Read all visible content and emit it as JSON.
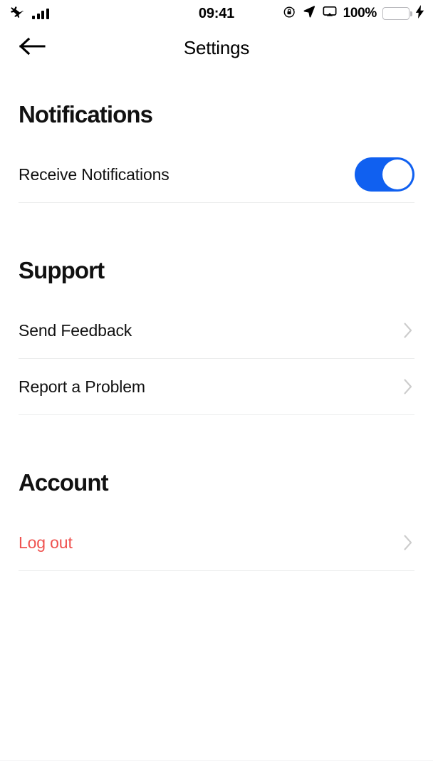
{
  "status_bar": {
    "airplane_icon": "airplane-mode-icon",
    "signal_icon": "cellular-signal-icon",
    "signal_bars": 4,
    "time": "09:41",
    "rotation_lock_icon": "rotation-lock-icon",
    "location_icon": "location-arrow-icon",
    "airplay_icon": "airplay-screen-mirroring-icon",
    "battery_percent": "100%",
    "battery_level": 100,
    "battery_color": "#4cd964",
    "charging_icon": "charging-bolt-icon"
  },
  "navbar": {
    "back_icon": "arrow-left-icon",
    "title": "Settings"
  },
  "sections": [
    {
      "id": "notifications",
      "title": "Notifications",
      "rows": [
        {
          "label": "Receive Notifications",
          "control": "toggle",
          "value": "on",
          "accent": "#1060f0"
        }
      ]
    },
    {
      "id": "support",
      "title": "Support",
      "rows": [
        {
          "label": "Send Feedback",
          "control": "chevron",
          "chevron_icon": "chevron-right-icon"
        },
        {
          "label": "Report a Problem",
          "control": "chevron",
          "chevron_icon": "chevron-right-icon"
        }
      ]
    },
    {
      "id": "account",
      "title": "Account",
      "rows": [
        {
          "label": "Log out",
          "control": "chevron",
          "chevron_icon": "chevron-right-icon",
          "style": "danger",
          "color": "#ef5350"
        }
      ]
    }
  ]
}
